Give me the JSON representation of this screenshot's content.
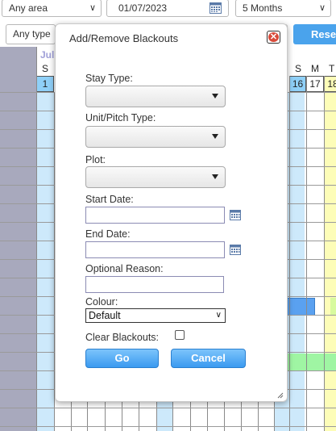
{
  "filters": {
    "area": "Any area",
    "date": "01/07/2023",
    "months": "5 Months",
    "type": "Any type",
    "reset_label": "Reset"
  },
  "calendar": {
    "month_label": "Jul",
    "first_dow": "S",
    "first_day": "1",
    "right_dows": [
      "S",
      "M",
      "T"
    ],
    "right_days": [
      "16",
      "17",
      "18"
    ]
  },
  "dialog": {
    "title": "Add/Remove Blackouts",
    "stay_type_label": "Stay Type:",
    "stay_type_value": "",
    "unit_type_label": "Unit/Pitch Type:",
    "unit_type_value": "",
    "plot_label": "Plot:",
    "plot_value": "",
    "start_date_label": "Start Date:",
    "start_date_value": "",
    "end_date_label": "End Date:",
    "end_date_value": "",
    "reason_label": "Optional Reason:",
    "reason_value": "",
    "colour_label": "Colour:",
    "colour_value": "Default",
    "clear_label": "Clear Blackouts:",
    "clear_checked": false,
    "go_label": "Go",
    "cancel_label": "Cancel"
  },
  "colors": {
    "accent_blue": "#4aa3ec",
    "weekend_blue": "#cde9fb",
    "today_yellow": "#fdfdb8",
    "close_red": "#d84a3a"
  }
}
